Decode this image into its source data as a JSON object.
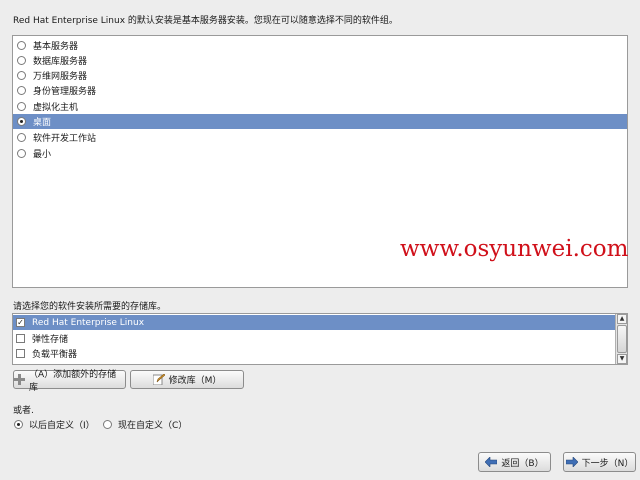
{
  "intro": "Red Hat Enterprise Linux 的默认安装是基本服务器安装。您现在可以随意选择不同的软件组。",
  "groups": [
    {
      "label": "基本服务器",
      "selected": false
    },
    {
      "label": "数据库服务器",
      "selected": false
    },
    {
      "label": "万维网服务器",
      "selected": false
    },
    {
      "label": "身份管理服务器",
      "selected": false
    },
    {
      "label": "虚拟化主机",
      "selected": false
    },
    {
      "label": "桌面",
      "selected": true
    },
    {
      "label": "软件开发工作站",
      "selected": false
    },
    {
      "label": "最小",
      "selected": false
    }
  ],
  "watermark": "www.osyunwei.com",
  "repos_label": "请选择您的软件安装所需要的存储库。",
  "repos": [
    {
      "label": "Red Hat Enterprise Linux",
      "checked": true
    },
    {
      "label": "弹性存储",
      "checked": false
    },
    {
      "label": "负载平衡器",
      "checked": false
    }
  ],
  "buttons": {
    "add_repo": "（A）添加额外的存储库",
    "modify_repo": "修改库（M）",
    "back": "返回（B）",
    "next": "下一步（N）"
  },
  "or_label": "或者.",
  "customize": {
    "later": "以后自定义（I）",
    "now": "现在自定义（C）",
    "selected": "later"
  },
  "colors": {
    "selection": "#6d8fc6",
    "watermark": "#d0101a"
  },
  "icons": {
    "add_repo": "plus-icon",
    "modify_repo": "edit-icon",
    "back": "arrow-left-icon",
    "next": "arrow-right-icon"
  }
}
